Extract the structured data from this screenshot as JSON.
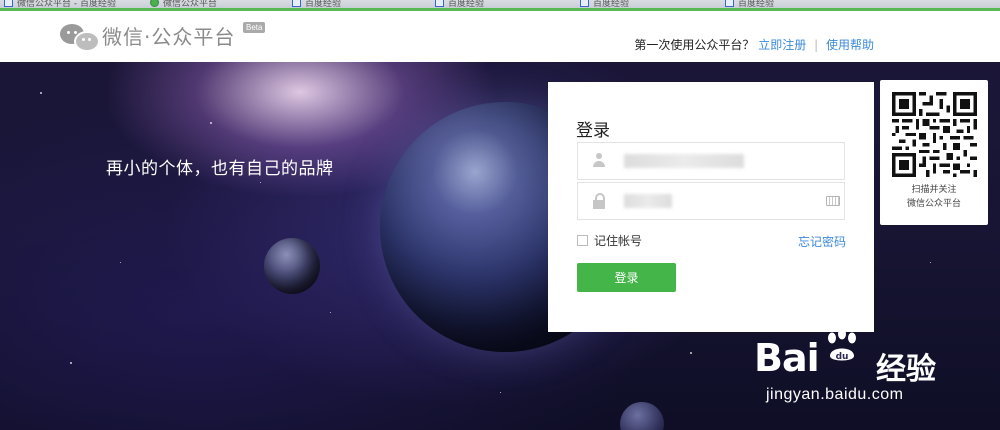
{
  "browser": {
    "tabs": [
      {
        "label": "微信公众平台 - 百度经验",
        "icon": "page-icon"
      },
      {
        "label": "微信公众平台",
        "icon": "wechat-icon"
      },
      {
        "label": "百度经验",
        "icon": "page-icon"
      },
      {
        "label": "百度经验",
        "icon": "page-icon"
      },
      {
        "label": "百度经验",
        "icon": "page-icon"
      },
      {
        "label": "百度经验",
        "icon": "page-icon"
      }
    ]
  },
  "header": {
    "logo_text": "微信·公众平台",
    "beta": "Beta",
    "prompt": "第一次使用公众平台？",
    "register_link": "立即注册",
    "separator": "|",
    "help_link": "使用帮助"
  },
  "hero": {
    "slogan": "再小的个体，也有自己的品牌"
  },
  "login": {
    "title": "登录",
    "username_value": "xxxxxxxxxxxxxxxx",
    "password_value": "••••••",
    "remember_label": "记住帐号",
    "forgot_link": "忘记密码",
    "submit_label": "登录"
  },
  "qr": {
    "line1": "扫描并关注",
    "line2": "微信公众平台"
  },
  "watermark": {
    "brand": "Bai",
    "brand_cn": "经验",
    "url": "jingyan.baidu.com"
  },
  "colors": {
    "accent_green": "#44b549",
    "link_blue": "#3c8bd9",
    "top_line": "#59b954"
  }
}
